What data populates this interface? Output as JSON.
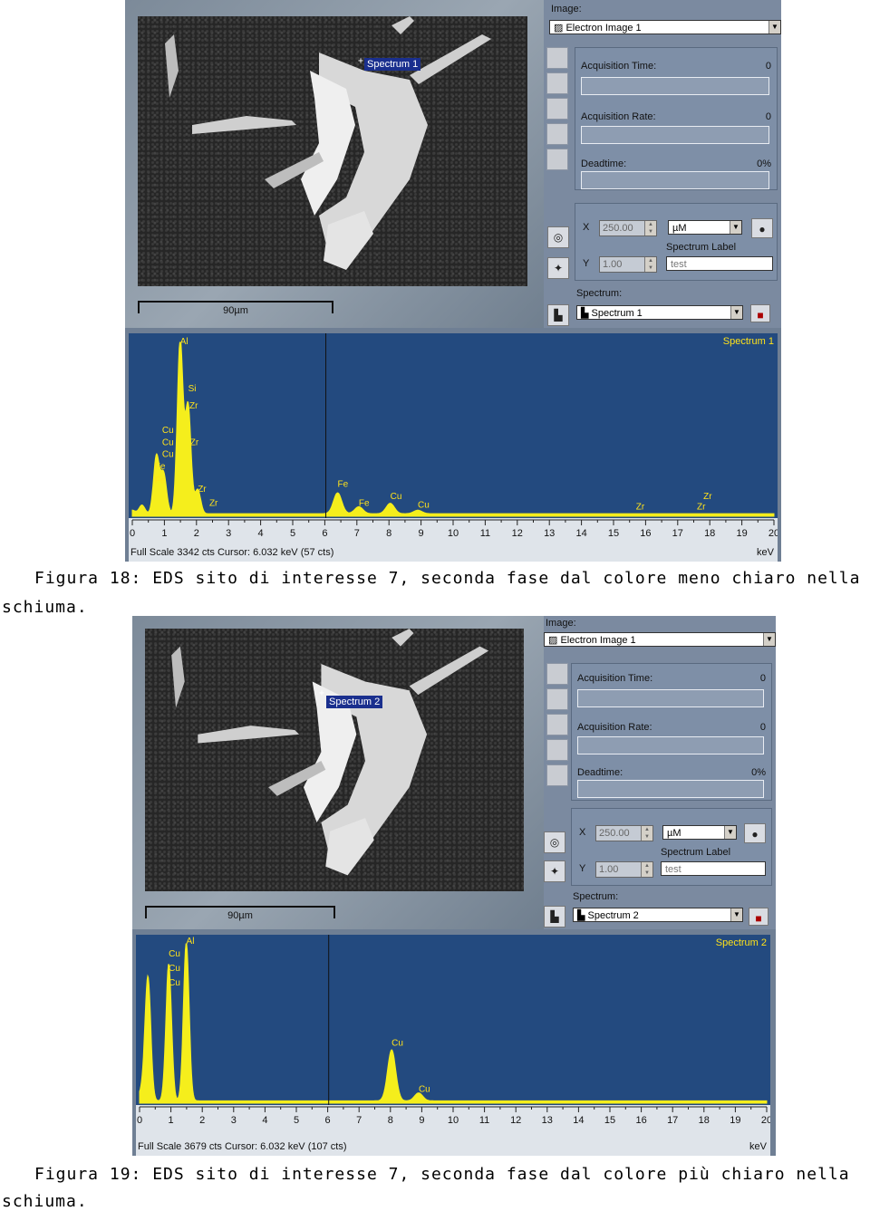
{
  "figures": [
    {
      "image_label": "Image:",
      "image_value": "Electron Image 1",
      "acquisition_time_label": "Acquisition Time:",
      "acquisition_time_value": "0",
      "acquisition_rate_label": "Acquisition Rate:",
      "acquisition_rate_value": "0",
      "deadtime_label": "Deadtime:",
      "deadtime_value": "0%",
      "x_label": "X",
      "x_value": "250.00",
      "y_label": "Y",
      "y_value": "1.00",
      "unit": "µM",
      "spectrum_label_title": "Spectrum Label",
      "spectrum_label_value": "test",
      "spectrum_title": "Spectrum:",
      "spectrum_value": "Spectrum 1",
      "overlay_tag": "Spectrum 1",
      "scale_text": "90µm",
      "plot_title": "Spectrum 1",
      "full_scale": "Full Scale 3342 cts  Cursor: 6.032 keV (57 cts)",
      "kev": "keV",
      "caption": "Figura 18: EDS sito di interesse 7, seconda fase dal colore meno chiaro nella",
      "caption_cont": "schiuma."
    },
    {
      "image_label": "Image:",
      "image_value": "Electron Image 1",
      "acquisition_time_label": "Acquisition Time:",
      "acquisition_time_value": "0",
      "acquisition_rate_label": "Acquisition Rate:",
      "acquisition_rate_value": "0",
      "deadtime_label": "Deadtime:",
      "deadtime_value": "0%",
      "x_label": "X",
      "x_value": "250.00",
      "y_label": "Y",
      "y_value": "1.00",
      "unit": "µM",
      "spectrum_label_title": "Spectrum Label",
      "spectrum_label_value": "test",
      "spectrum_title": "Spectrum:",
      "spectrum_value": "Spectrum 2",
      "overlay_tag": "Spectrum 2",
      "scale_text": "90µm",
      "plot_title": "Spectrum 2",
      "full_scale": "Full Scale 3679 cts  Cursor: 6.032 keV (107 cts)",
      "kev": "keV",
      "caption": "Figura 19: EDS sito di interesse 7, seconda fase dal colore più chiaro nella",
      "caption_cont": "schiuma."
    }
  ],
  "chart_data": [
    {
      "type": "area",
      "title": "Spectrum 1",
      "xlabel": "keV",
      "x_ticks": [
        "0",
        "1",
        "2",
        "3",
        "4",
        "5",
        "6",
        "7",
        "8",
        "9",
        "10",
        "11",
        "12",
        "13",
        "14",
        "15",
        "16",
        "17",
        "18",
        "19",
        "20"
      ],
      "xlim": [
        0,
        20
      ],
      "cursor_kev": 6.032,
      "peaks": [
        {
          "kev": 0.0,
          "height": 0.02
        },
        {
          "kev": 0.3,
          "height": 0.05
        },
        {
          "kev": 0.75,
          "height": 0.33
        },
        {
          "kev": 0.95,
          "height": 0.12
        },
        {
          "kev": 1.0,
          "height": 0.12
        },
        {
          "kev": 1.49,
          "height": 1.0
        },
        {
          "kev": 1.74,
          "height": 0.62
        },
        {
          "kev": 2.04,
          "height": 0.14
        },
        {
          "kev": 6.4,
          "height": 0.12
        },
        {
          "kev": 7.06,
          "height": 0.04
        },
        {
          "kev": 8.04,
          "height": 0.06
        },
        {
          "kev": 8.9,
          "height": 0.02
        }
      ],
      "line_labels": [
        {
          "text": "Al",
          "kev": 1.49,
          "level": 0.99
        },
        {
          "text": "Si",
          "kev": 1.74,
          "level": 0.72
        },
        {
          "text": "Zr",
          "kev": 1.78,
          "level": 0.62
        },
        {
          "text": "Cu",
          "kev": 0.93,
          "level": 0.48
        },
        {
          "text": "Cu",
          "kev": 0.93,
          "level": 0.41
        },
        {
          "text": "Cu",
          "kev": 0.93,
          "level": 0.34
        },
        {
          "text": "Fe",
          "kev": 0.7,
          "level": 0.27
        },
        {
          "text": "Fe",
          "kev": 0.7,
          "level": 0.19
        },
        {
          "text": "Zr",
          "kev": 1.8,
          "level": 0.41
        },
        {
          "text": "Zr",
          "kev": 2.04,
          "level": 0.14
        },
        {
          "text": "Zr",
          "kev": 2.4,
          "level": 0.06
        },
        {
          "text": "Fe",
          "kev": 6.4,
          "level": 0.17
        },
        {
          "text": "Fe",
          "kev": 7.06,
          "level": 0.06
        },
        {
          "text": "Cu",
          "kev": 8.04,
          "level": 0.1
        },
        {
          "text": "Cu",
          "kev": 8.9,
          "level": 0.05
        },
        {
          "text": "Zr",
          "kev": 15.7,
          "level": 0.04
        },
        {
          "text": "Zr",
          "kev": 17.6,
          "level": 0.04
        },
        {
          "text": "Zr",
          "kev": 17.8,
          "level": 0.1
        }
      ]
    },
    {
      "type": "area",
      "title": "Spectrum 2",
      "xlabel": "keV",
      "x_ticks": [
        "0",
        "1",
        "2",
        "3",
        "4",
        "5",
        "6",
        "7",
        "8",
        "9",
        "10",
        "11",
        "12",
        "13",
        "14",
        "15",
        "16",
        "17",
        "18",
        "19",
        "20"
      ],
      "xlim": [
        0,
        20
      ],
      "cursor_kev": 6.032,
      "peaks": [
        {
          "kev": 0.0,
          "height": 0.03
        },
        {
          "kev": 0.15,
          "height": 0.08
        },
        {
          "kev": 0.27,
          "height": 0.75
        },
        {
          "kev": 0.93,
          "height": 0.86
        },
        {
          "kev": 1.49,
          "height": 1.0
        },
        {
          "kev": 8.04,
          "height": 0.32
        },
        {
          "kev": 8.9,
          "height": 0.05
        }
      ],
      "line_labels": [
        {
          "text": "Cu",
          "kev": 0.93,
          "level": 0.92
        },
        {
          "text": "Cu",
          "kev": 0.93,
          "level": 0.83
        },
        {
          "text": "Cu",
          "kev": 0.93,
          "level": 0.74
        },
        {
          "text": "Al",
          "kev": 1.49,
          "level": 1.0
        },
        {
          "text": "Cu",
          "kev": 8.04,
          "level": 0.36
        },
        {
          "text": "Cu",
          "kev": 8.9,
          "level": 0.07
        }
      ]
    }
  ],
  "colors": {
    "spectrum_bg": "#234a7f",
    "peak_fill": "#f5ee1c",
    "label_text": "#ffe21a",
    "spectrum_tag_bg": "#1a2f8e"
  }
}
